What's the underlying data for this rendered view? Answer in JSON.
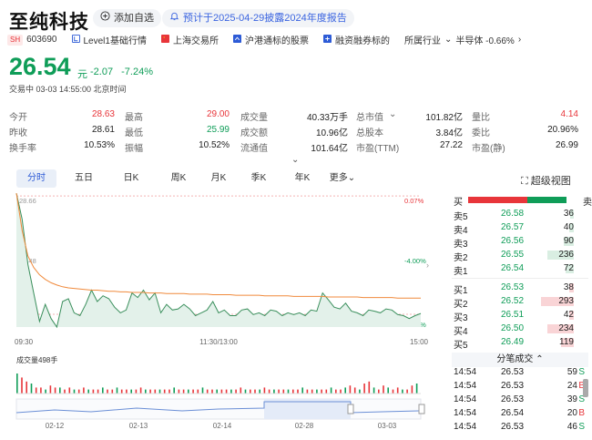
{
  "header": {
    "name": "至纯科技",
    "add_watch": "添加自选",
    "report_notice": "预计于2025-04-29披露2024年度报告"
  },
  "sub": {
    "market_tag": "SH",
    "code": "603690",
    "level": "Level1基础行情",
    "exchange": "上海交易所",
    "connect": "沪港通标的股票",
    "margin": "融资融券标的",
    "industry_label": "所属行业",
    "sector": "半导体 -0.66%"
  },
  "quote": {
    "price": "26.54",
    "unit": "元",
    "change": "-2.07",
    "pct": "-7.24%",
    "status": "交易中 03-03 14:55:00 北京时间"
  },
  "stats": [
    [
      {
        "l": "今开",
        "v": "28.63",
        "c": "up"
      },
      {
        "l": "最高",
        "v": "29.00",
        "c": "up"
      },
      {
        "l": "成交量",
        "v": "40.33万手",
        "c": ""
      },
      {
        "l": "总市值",
        "v": "101.82亿",
        "c": "",
        "chev": true
      },
      {
        "l": "量比",
        "v": "4.14",
        "c": "up"
      }
    ],
    [
      {
        "l": "昨收",
        "v": "28.61",
        "c": ""
      },
      {
        "l": "最低",
        "v": "25.99",
        "c": "dn"
      },
      {
        "l": "成交额",
        "v": "10.96亿",
        "c": ""
      },
      {
        "l": "总股本",
        "v": "3.84亿",
        "c": ""
      },
      {
        "l": "委比",
        "v": "20.96%",
        "c": ""
      }
    ],
    [
      {
        "l": "换手率",
        "v": "10.53%",
        "c": ""
      },
      {
        "l": "振幅",
        "v": "10.52%",
        "c": ""
      },
      {
        "l": "流通值",
        "v": "101.64亿",
        "c": ""
      },
      {
        "l": "市盈(TTM)",
        "v": "27.22",
        "c": ""
      },
      {
        "l": "市盈(静)",
        "v": "26.99",
        "c": ""
      }
    ]
  ],
  "tabs": [
    "分时",
    "五日",
    "日K",
    "周K",
    "月K",
    "季K",
    "年K",
    "更多"
  ],
  "superview": "超级视图",
  "chart_data": {
    "type": "line",
    "yticks_left": [
      "28.66",
      "27.48",
      "26.30"
    ],
    "yticks_right": [
      "0.07%",
      "-4.00%",
      "-8.07%"
    ],
    "xticks": [
      "09:30",
      "11:30/13:00",
      "15:00"
    ],
    "ylim": [
      26.3,
      28.66
    ],
    "ref_price": 28.61,
    "series": [
      {
        "values": [
          28.66,
          28.2,
          27.4,
          26.9,
          26.4,
          26.7,
          26.45,
          26.3,
          26.75,
          26.8,
          26.55,
          26.5,
          26.7,
          26.95,
          26.75,
          26.85,
          26.8,
          26.65,
          26.55,
          26.6,
          26.9,
          26.82,
          26.95,
          26.78,
          26.9,
          26.55,
          26.7,
          26.6,
          26.62,
          26.7,
          26.62,
          26.5,
          26.55,
          26.6,
          26.75,
          26.55,
          26.6,
          26.5,
          26.5,
          26.6,
          26.62,
          26.52,
          26.55,
          26.5,
          26.6,
          26.58,
          26.5,
          26.55,
          26.52,
          26.55,
          26.5,
          26.6,
          26.58,
          26.9,
          26.78,
          26.65,
          26.62,
          26.72,
          26.58,
          26.55,
          26.5,
          26.6,
          26.58,
          26.55,
          26.62,
          26.6,
          26.52,
          26.5,
          26.45,
          26.5,
          26.54
        ]
      },
      {
        "values": [
          28.66,
          28.0,
          27.55,
          27.35,
          27.22,
          27.14,
          27.08,
          27.04,
          27.01,
          26.99,
          26.98,
          26.97,
          26.96,
          26.95,
          26.95,
          26.94,
          26.93,
          26.93,
          26.92,
          26.92,
          26.91,
          26.91,
          26.91,
          26.9,
          26.9,
          26.9,
          26.89,
          26.89,
          26.89,
          26.89,
          26.88,
          26.88,
          26.88,
          26.88,
          26.87,
          26.87,
          26.87,
          26.87,
          26.86,
          26.86,
          26.86,
          26.86,
          26.86,
          26.85,
          26.85,
          26.85,
          26.85,
          26.85,
          26.84,
          26.84,
          26.84,
          26.84,
          26.84,
          26.84,
          26.83,
          26.83,
          26.83,
          26.83,
          26.83,
          26.83,
          26.82,
          26.82,
          26.82,
          26.82,
          26.82,
          26.82,
          26.81,
          26.81,
          26.81,
          26.81,
          26.81
        ]
      }
    ],
    "volume_label": "成交量498手",
    "volume": [
      10,
      8,
      6,
      5,
      3,
      3,
      2,
      4,
      3,
      3,
      2,
      3,
      2,
      2,
      3,
      2,
      2,
      2,
      3,
      2,
      2,
      3,
      2,
      2,
      2,
      2,
      3,
      2,
      2,
      2,
      2,
      2,
      2,
      3,
      2,
      2,
      2,
      2,
      2,
      3,
      2,
      2,
      2,
      2,
      2,
      2,
      2,
      3,
      2,
      2,
      2,
      2,
      3,
      2,
      2,
      2,
      2,
      2,
      2,
      2,
      3,
      2,
      2,
      2,
      2,
      2,
      3,
      2,
      2,
      3,
      4,
      3,
      2,
      5,
      6,
      3,
      2,
      4,
      3,
      2,
      3,
      2,
      2,
      4,
      5
    ],
    "nav_dates": [
      "02-12",
      "02-13",
      "02-14",
      "02-28",
      "03-03"
    ]
  },
  "orderbook": {
    "header_sell": "卖",
    "header_buy": "买",
    "sells": [
      {
        "l": "卖5",
        "p": "26.58",
        "v": "36",
        "bar": 0.09
      },
      {
        "l": "卖4",
        "p": "26.57",
        "v": "40",
        "bar": 0.1
      },
      {
        "l": "卖3",
        "p": "26.56",
        "v": "90",
        "bar": 0.22
      },
      {
        "l": "卖2",
        "p": "26.55",
        "v": "236",
        "bar": 0.6
      },
      {
        "l": "卖1",
        "p": "26.54",
        "v": "72",
        "bar": 0.18
      }
    ],
    "buys": [
      {
        "l": "买1",
        "p": "26.53",
        "v": "38",
        "bar": 0.1
      },
      {
        "l": "买2",
        "p": "26.52",
        "v": "293",
        "bar": 0.75
      },
      {
        "l": "买3",
        "p": "26.51",
        "v": "42",
        "bar": 0.11
      },
      {
        "l": "买4",
        "p": "26.50",
        "v": "234",
        "bar": 0.6
      },
      {
        "l": "买5",
        "p": "26.49",
        "v": "119",
        "bar": 0.3
      }
    ],
    "ratio_buy": 0.6
  },
  "trades": {
    "title": "分笔成交",
    "rows": [
      {
        "t": "14:54",
        "p": "26.53",
        "v": "59",
        "s": "S"
      },
      {
        "t": "14:54",
        "p": "26.53",
        "v": "24",
        "s": "B"
      },
      {
        "t": "14:54",
        "p": "26.53",
        "v": "39",
        "s": "S"
      },
      {
        "t": "14:54",
        "p": "26.54",
        "v": "20",
        "s": "B"
      },
      {
        "t": "14:54",
        "p": "26.53",
        "v": "46",
        "s": "S"
      }
    ]
  },
  "colors": {
    "up": "#e8353a",
    "down": "#0f9d58",
    "price_line": "#3a8f5c",
    "avg_line": "#f08a3c",
    "accent": "#2d5bd6"
  }
}
